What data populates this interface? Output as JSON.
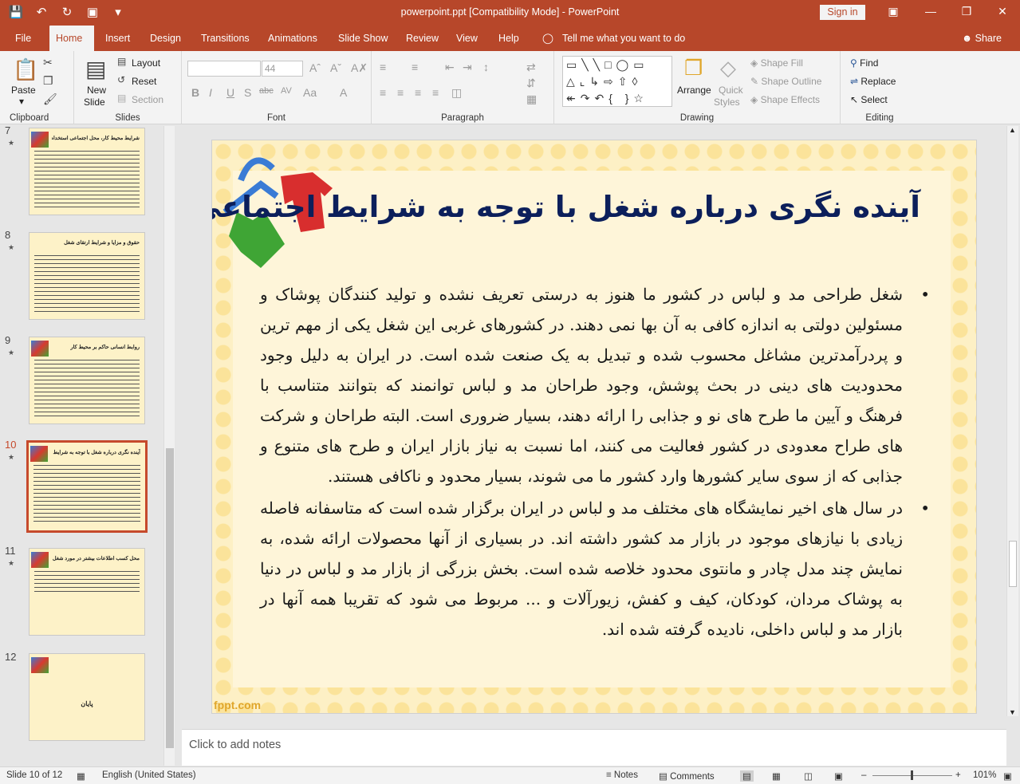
{
  "app": {
    "title": "powerpoint.ppt [Compatibility Mode]  -  PowerPoint",
    "sign_in": "Sign in",
    "share": "Share",
    "tell_me": "Tell me what you want to do"
  },
  "tabs": [
    "File",
    "Home",
    "Insert",
    "Design",
    "Transitions",
    "Animations",
    "Slide Show",
    "Review",
    "View",
    "Help"
  ],
  "ribbon": {
    "clipboard": {
      "label": "Clipboard",
      "paste": "Paste"
    },
    "slides": {
      "label": "Slides",
      "new_slide": "New",
      "new_slide2": "Slide",
      "layout": "Layout",
      "reset": "Reset",
      "section": "Section"
    },
    "font": {
      "label": "Font",
      "size": "44"
    },
    "paragraph": {
      "label": "Paragraph"
    },
    "drawing": {
      "label": "Drawing",
      "arrange": "Arrange",
      "quick": "Quick",
      "styles": "Styles",
      "fill": "Shape Fill",
      "outline": "Shape Outline",
      "effects": "Shape Effects"
    },
    "editing": {
      "label": "Editing",
      "find": "Find",
      "replace": "Replace",
      "select": "Select"
    }
  },
  "thumbs": [
    {
      "num": "7",
      "title": "شرایط محیط کار، محل اجتماعی استخدام و"
    },
    {
      "num": "8",
      "title": "حقوق و مزایا و شرایط ارتقای شغل"
    },
    {
      "num": "9",
      "title": "روابط انسانی حاکم بر محیط کار"
    },
    {
      "num": "10",
      "title": "آینده نگری درباره شغل با توجه به شرایط اجتماعی"
    },
    {
      "num": "11",
      "title": "محل کسب اطلاعات بیشتر در مورد شغل"
    },
    {
      "num": "12",
      "title": "پایان"
    }
  ],
  "slide": {
    "title": "آینده نگری درباره شغل با توجه به شرایط اجتماعی",
    "para1": "شغل طراحی مد و لباس در کشور ما هنوز به درستی تعریف نشده و  تولید کنندگان پوشاک و مسئولین دولتی به اندازه کافی به آن بها نمی دهند. در کشورهای غربی این شغل یکی از مهم ترین و پردرآمدترین مشاغل محسوب شده و تبدیل به یک صنعت شده است. در ایران به دلیل وجود محدودیت های دینی در بحث پوشش، وجود طراحان مد و لباس توانمند که بتوانند متناسب با فرهنگ و آیین ما طرح های نو و جذابی را ارائه دهند، بسیار ضروری است. البته طراحان و شرکت های طراح معدودی در کشور فعالیت می کنند، اما نسبت به نیاز بازار ایران و طرح های متنوع و جذابی که از سوی سایر کشورها وارد کشور ما می شوند، بسیار محدود و ناکافی هستند.",
    "para2": "در سال های اخیر نمایشگاه های مختلف مد و لباس در ایران برگزار شده است که متاسفانه فاصله زیادی با نیازهای موجود در بازار مد کشور داشته اند. در بسیاری از آنها محصولات ارائه شده، به نمایش چند مدل چادر و مانتوی محدود خلاصه شده است. بخش بزرگی از بازار مد و لباس در دنیا به پوشاک مردان، کودکان، کیف و کفش، زیورآلات و ... مربوط می شود که تقریبا همه آنها در بازار مد و لباس داخلی، نادیده گرفته شده اند.",
    "footer": "fppt.com"
  },
  "notes_placeholder": "Click to add notes",
  "status": {
    "slide": "Slide 10 of 12",
    "language": "English (United States)",
    "notes": "Notes",
    "comments": "Comments",
    "zoom": "101%"
  }
}
